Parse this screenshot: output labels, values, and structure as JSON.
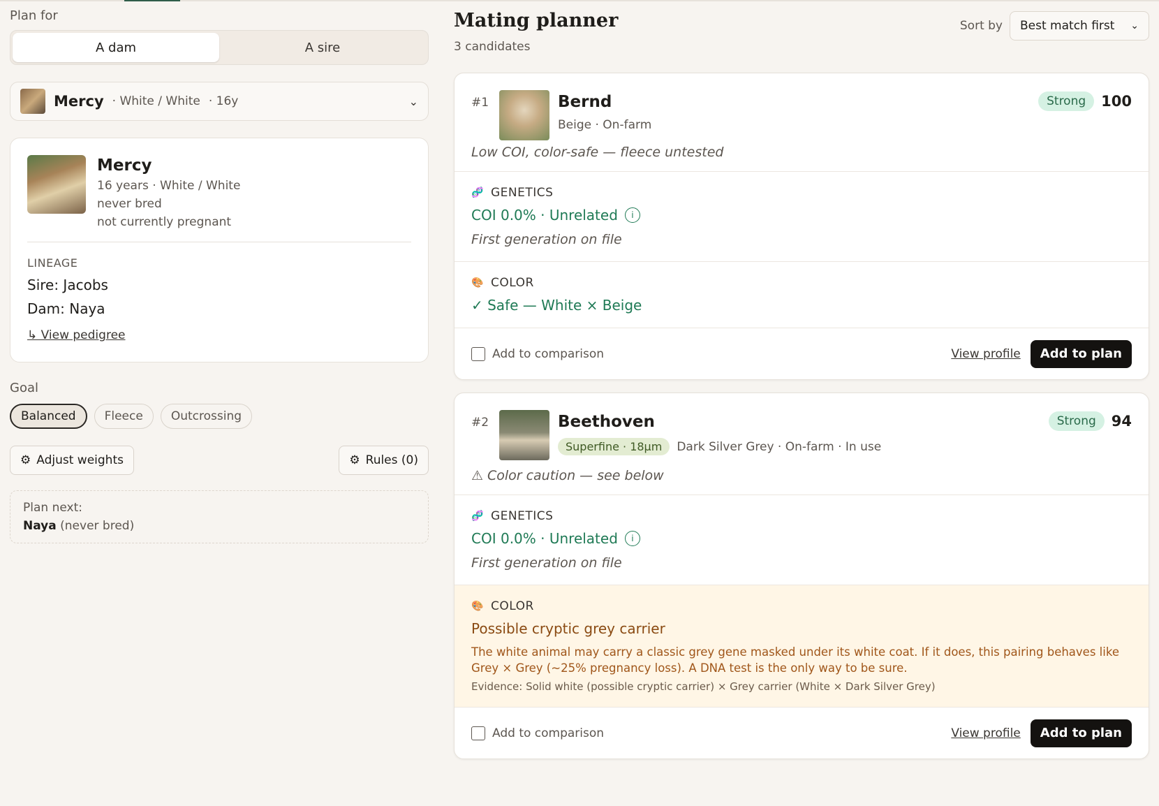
{
  "left": {
    "plan_for_label": "Plan for",
    "segments": [
      "A dam",
      "A sire"
    ],
    "picker": {
      "name": "Mercy",
      "meta1": "· White / White",
      "meta2": "· 16y"
    },
    "card": {
      "name": "Mercy",
      "line1": "16 years · White / White",
      "line2": "never bred",
      "line3": "not currently pregnant",
      "lineage_label": "LINEAGE",
      "sire": "Sire: Jacobs",
      "dam": "Dam: Naya",
      "pedigree_link": "↳ View pedigree"
    },
    "goal_label": "Goal",
    "goals": [
      "Balanced",
      "Fleece",
      "Outcrossing"
    ],
    "adjust_weights": "Adjust weights",
    "rules": "Rules (0)",
    "plan_next_label": "Plan next:",
    "plan_next_name": "Naya",
    "plan_next_note": "(never bred)"
  },
  "right": {
    "title": "Mating planner",
    "count": "3 candidates",
    "sort_label": "Sort by",
    "sort_value": "Best match first",
    "candidates": [
      {
        "rank": "#1",
        "name": "Bernd",
        "sub": "Beige · On-farm",
        "badge": "Strong",
        "score": "100",
        "summary": "Low COI, color-safe — fleece untested",
        "genetics_label": "GENETICS",
        "coi": "COI 0.0% · Unrelated",
        "gen_note": "First generation on file",
        "color_label": "COLOR",
        "color_value": "✓ Safe — White × Beige",
        "compare": "Add to comparison",
        "view": "View profile",
        "add": "Add to plan"
      },
      {
        "rank": "#2",
        "name": "Beethoven",
        "fineness": "Superfine · 18µm",
        "sub": "Dark Silver Grey · On-farm · In use",
        "badge": "Strong",
        "score": "94",
        "summary": "⚠ Color caution — see below",
        "genetics_label": "GENETICS",
        "coi": "COI 0.0% · Unrelated",
        "gen_note": "First generation on file",
        "color_label": "COLOR",
        "warn_title": "Possible cryptic grey carrier",
        "warn_desc": "The white animal may carry a classic grey gene masked under its white coat. If it does, this pairing behaves like Grey × Grey (~25% pregnancy loss). A DNA test is the only way to be sure.",
        "evidence": "Evidence: Solid white (possible cryptic carrier) × Grey carrier (White × Dark Silver Grey)",
        "compare": "Add to comparison",
        "view": "View profile",
        "add": "Add to plan"
      }
    ]
  }
}
